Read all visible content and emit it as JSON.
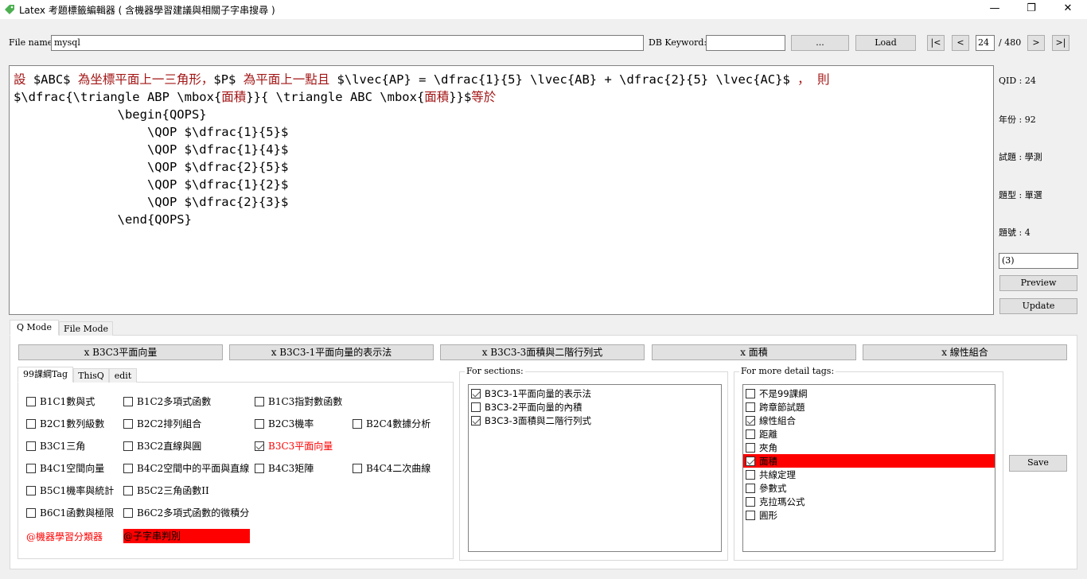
{
  "window": {
    "title": "Latex 考題標籤編輯器 ( 含機器學習建議與相關子字串搜尋 )",
    "min": "—",
    "max": "❐",
    "close": "✕"
  },
  "toolbar": {
    "file_label": "File name:",
    "file_value": "mysql",
    "db_label": "DB Keyword:",
    "db_value": "",
    "browse": "...",
    "load": "Load",
    "first": "|<",
    "prev": "<",
    "page": "24",
    "total": "/ 480",
    "next": ">",
    "last": ">|"
  },
  "editor": {
    "lines": [
      [
        {
          "t": "設 ",
          "c": 1
        },
        {
          "t": "$ABC$ ",
          "c": 0
        },
        {
          "t": "為坐標平面上一三角形，",
          "c": 1
        },
        {
          "t": "$P$ ",
          "c": 0
        },
        {
          "t": "為平面上一點且 ",
          "c": 1
        },
        {
          "t": "$\\lvec{AP} = \\dfrac{1}{5} \\lvec{AB} + \\dfrac{2}{5} \\lvec{AC}$ ",
          "c": 0
        },
        {
          "t": "， 則",
          "c": 1
        }
      ],
      [
        {
          "t": "$\\dfrac{\\triangle ABP \\mbox{",
          "c": 0
        },
        {
          "t": "面積",
          "c": 1
        },
        {
          "t": "}}{ \\triangle ABC \\mbox{",
          "c": 0
        },
        {
          "t": "面積",
          "c": 1
        },
        {
          "t": "}}$",
          "c": 0
        },
        {
          "t": "等於",
          "c": 1
        }
      ],
      [
        {
          "t": "              \\begin{QOPS}",
          "c": 0
        }
      ],
      [
        {
          "t": "                  \\QOP $\\dfrac{1}{5}$",
          "c": 0
        }
      ],
      [
        {
          "t": "                  \\QOP $\\dfrac{1}{4}$",
          "c": 0
        }
      ],
      [
        {
          "t": "                  \\QOP $\\dfrac{2}{5}$",
          "c": 0
        }
      ],
      [
        {
          "t": "                  \\QOP $\\dfrac{1}{2}$",
          "c": 0
        }
      ],
      [
        {
          "t": "                  \\QOP $\\dfrac{2}{3}$",
          "c": 0
        }
      ],
      [
        {
          "t": "              \\end{QOPS}",
          "c": 0
        }
      ]
    ]
  },
  "info": {
    "qid": "QID : 24",
    "year": "年份 : 92",
    "exam": "試題 : 學測",
    "type": "題型 : 單選",
    "number": "題號 : 4",
    "answer": "(3)",
    "preview": "Preview",
    "update": "Update"
  },
  "tabs": {
    "q_mode": "Q Mode",
    "file_mode": "File Mode"
  },
  "tag_buttons": [
    "x B3C3平面向量",
    "x B3C3-1平面向量的表示法",
    "x B3C3-3面積與二階行列式",
    "x 面積",
    "x 線性組合"
  ],
  "inner_tabs": [
    "99課綱Tag",
    "ThisQ",
    "edit"
  ],
  "syllabus": [
    [
      {
        "label": "B1C1數與式",
        "checked": false
      },
      {
        "label": "B1C2多項式函數",
        "checked": false
      },
      {
        "label": "B1C3指對數函數",
        "checked": false
      },
      null
    ],
    [
      {
        "label": "B2C1數列級數",
        "checked": false
      },
      {
        "label": "B2C2排列組合",
        "checked": false
      },
      {
        "label": "B2C3機率",
        "checked": false
      },
      {
        "label": "B2C4數據分析",
        "checked": false
      }
    ],
    [
      {
        "label": "B3C1三角",
        "checked": false
      },
      {
        "label": "B3C2直線與圓",
        "checked": false
      },
      {
        "label": "B3C3平面向量",
        "checked": true
      },
      null
    ],
    [
      {
        "label": "B4C1空間向量",
        "checked": false
      },
      {
        "label": "B4C2空間中的平面與直線",
        "checked": false
      },
      {
        "label": "B4C3矩陣",
        "checked": false
      },
      {
        "label": "B4C4二次曲線",
        "checked": false
      }
    ],
    [
      {
        "label": "B5C1機率與統計",
        "checked": false
      },
      {
        "label": "B5C2三角函數II",
        "checked": false
      },
      null,
      null
    ],
    [
      {
        "label": "B6C1函數與極限",
        "checked": false
      },
      {
        "label": "B6C2多項式函數的微積分",
        "checked": false
      },
      null,
      null
    ]
  ],
  "ml_classifier": "@機器學習分類器",
  "substring": "@子字串判別",
  "sections": {
    "label": "For sections:",
    "items": [
      {
        "label": "B3C3-1平面向量的表示法",
        "checked": true
      },
      {
        "label": "B3C3-2平面向量的內積",
        "checked": false
      },
      {
        "label": "B3C3-3面積與二階行列式",
        "checked": true
      }
    ]
  },
  "details": {
    "label": "For more detail tags:",
    "items": [
      {
        "label": "不是99課綱",
        "checked": false
      },
      {
        "label": "跨章節試題",
        "checked": false
      },
      {
        "label": "線性組合",
        "checked": true
      },
      {
        "label": "距離",
        "checked": false
      },
      {
        "label": "夾角",
        "checked": false
      },
      {
        "label": "面積",
        "checked": true,
        "selected": true
      },
      {
        "label": "共線定理",
        "checked": false
      },
      {
        "label": "參數式",
        "checked": false
      },
      {
        "label": "克拉瑪公式",
        "checked": false
      },
      {
        "label": "圓形",
        "checked": false
      }
    ]
  },
  "save": "Save"
}
